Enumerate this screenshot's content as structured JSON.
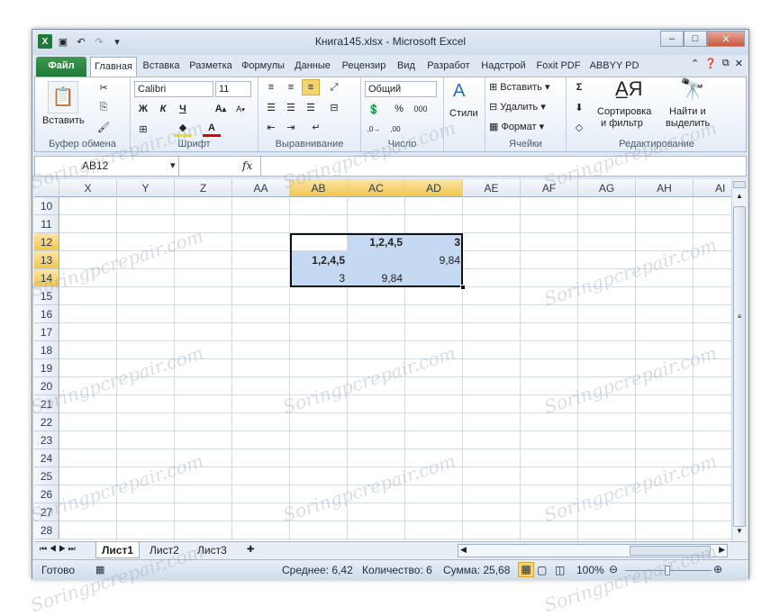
{
  "window": {
    "title": "Книга145.xlsx - Microsoft Excel"
  },
  "tabs": [
    "Файл",
    "Главная",
    "Вставка",
    "Разметка",
    "Формулы",
    "Данные",
    "Рецензир",
    "Вид",
    "Разработ",
    "Надстрой",
    "Foxit PDF",
    "ABBYY PD"
  ],
  "ribbon": {
    "clipboard": {
      "paste": "Вставить",
      "label": "Буфер обмена"
    },
    "font": {
      "name": "Calibri",
      "size": "11",
      "bold": "Ж",
      "italic": "К",
      "underline": "Ч",
      "label": "Шрифт"
    },
    "alignment": {
      "label": "Выравнивание"
    },
    "number": {
      "format": "Общий",
      "label": "Число"
    },
    "styles": {
      "label": "Стили"
    },
    "cells": {
      "insert": "Вставить",
      "delete": "Удалить",
      "format": "Формат",
      "label": "Ячейки"
    },
    "editing": {
      "sort": "Сортировка",
      "sort2": "и фильтр",
      "find": "Найти и",
      "find2": "выделить",
      "label": "Редактирование"
    }
  },
  "formula_bar": {
    "name_box": "AB12",
    "fx": "fx",
    "formula": ""
  },
  "columns": [
    "X",
    "Y",
    "Z",
    "AA",
    "AB",
    "AC",
    "AD",
    "AE",
    "AF",
    "AG",
    "AH",
    "AI"
  ],
  "rows": [
    "10",
    "11",
    "12",
    "13",
    "14",
    "15",
    "16",
    "17",
    "18",
    "19",
    "20",
    "21",
    "22",
    "23",
    "24",
    "25",
    "26",
    "27",
    "28"
  ],
  "cells": {
    "r12_ac": "1,2,4,5",
    "r12_ad": "3",
    "r13_ab": "1,2,4,5",
    "r13_ad": "9,84",
    "r14_ab": "3",
    "r14_ac": "9,84"
  },
  "sheets": [
    "Лист1",
    "Лист2",
    "Лист3"
  ],
  "status": {
    "ready": "Готово",
    "average": "Среднее: 6,42",
    "count": "Количество: 6",
    "sum": "Сумма: 25,68",
    "zoom": "100%"
  },
  "watermark": "Soringpcrepair.com",
  "colors": {
    "selection": "#c5daf2",
    "header_selected": "#f2c64d",
    "file_tab": "#1f7a3a"
  }
}
